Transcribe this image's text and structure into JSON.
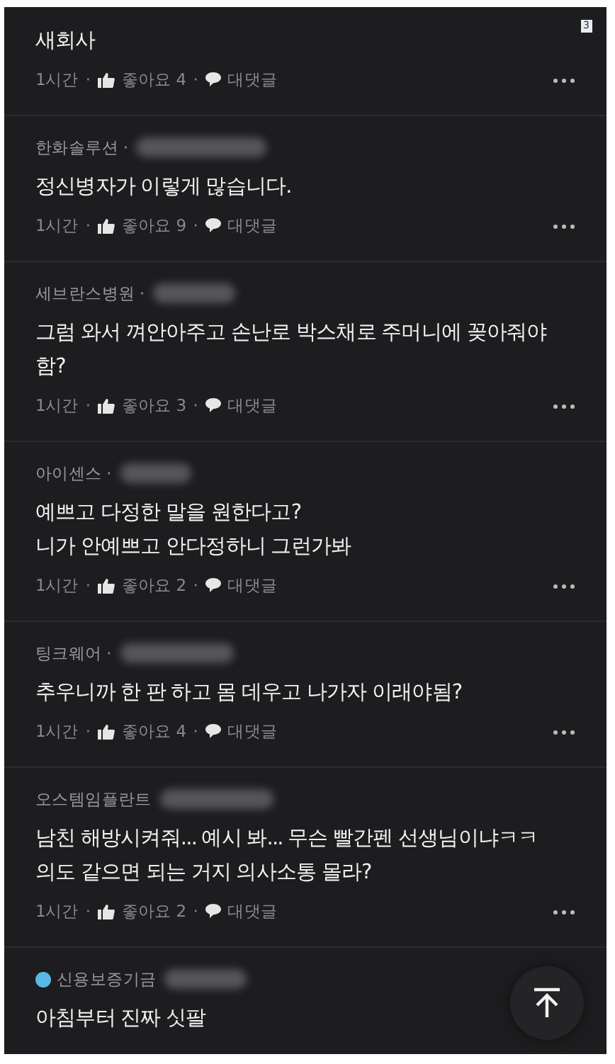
{
  "corner_badge": "3",
  "separator": "·",
  "comments": [
    {
      "text": "새회사",
      "time": "1시간",
      "likes": "좋아요 4",
      "reply": "대댓글"
    },
    {
      "author": "한화솔루션 ·",
      "redacted": true,
      "text": "정신병자가 이렇게 많습니다.",
      "time": "1시간",
      "likes": "좋아요 9",
      "reply": "대댓글"
    },
    {
      "author": "세브란스병원 ·",
      "redacted": true,
      "text": "그럼 와서 껴안아주고 손난로 박스채로 주머니에 꽂아줘야함?",
      "time": "1시간",
      "likes": "좋아요 3",
      "reply": "대댓글"
    },
    {
      "author": "아이센스 ·",
      "redacted": true,
      "text": "예쁘고 다정한 말을 원한다고?\n니가 안예쁘고 안다정하니 그런가봐",
      "time": "1시간",
      "likes": "좋아요 2",
      "reply": "대댓글"
    },
    {
      "author": "팅크웨어 ·",
      "redacted": true,
      "text": "추우니까 한 판 하고 몸 데우고 나가자 이래야됨?",
      "time": "1시간",
      "likes": "좋아요 4",
      "reply": "대댓글"
    },
    {
      "author": "오스템임플란트",
      "redacted": true,
      "text": "남친 해방시켜줘... 예시 봐... 무슨 빨간펜 선생님이냐ㅋㅋ\n의도 같으면 되는 거지 의사소통 몰라?",
      "time": "1시간",
      "likes": "좋아요 2",
      "reply": "대댓글"
    },
    {
      "author": "신용보증기금",
      "badge": true,
      "redacted": true,
      "text": "아침부터 진짜 싯팔"
    }
  ],
  "top_button": {
    "kind": "scroll-top"
  }
}
